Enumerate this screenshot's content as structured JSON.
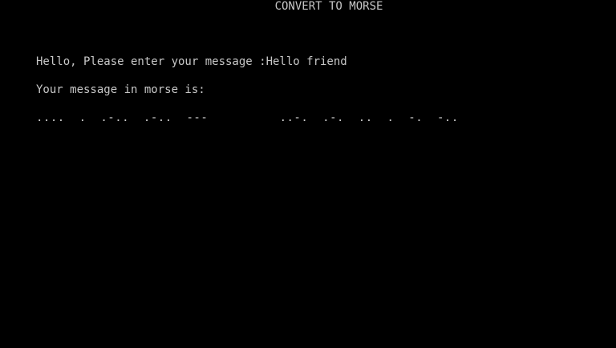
{
  "screen": {
    "title": "CONVERT TO MORSE",
    "prompt_label": "Hello, Please enter your message :",
    "prompt_value": "Hello friend",
    "result_label": "Your message in morse is:",
    "morse_output": "....  .  .-..  .-..  ---          ..-.  .-.  ..  .  -.  -.."
  },
  "colors": {
    "background": "#000000",
    "text": "#c8c8c8"
  }
}
